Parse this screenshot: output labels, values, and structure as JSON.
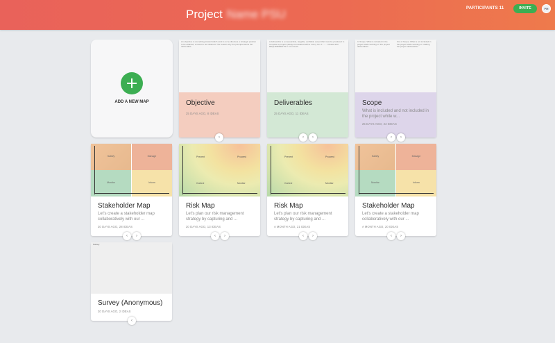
{
  "header": {
    "title": "Project",
    "title_blurred": "Name PSU",
    "participants": "PARTICIPANTS 11",
    "invite": "INVITE",
    "avatar": "PM"
  },
  "add_map": {
    "label": "ADD A NEW MAP"
  },
  "cards": {
    "objective": {
      "title": "Objective",
      "meta": "25 DAYS AGO, 8 IDEAS",
      "thumb_text": "An objective is something toward which work is to be directed, a strategic position to be attained, a result to be obtained. The reason why the principal wants the deliverable."
    },
    "deliverables": {
      "title": "Deliverables",
      "meta": "25 DAYS AGO, 11 IDEAS",
      "thumb_text": "A deliverable is a measurable, tangible, verifiable output that must be produced to complete a project (always formulated with a noun). Ex: A ........ Please add REQUIREMENTS in comments"
    },
    "scope": {
      "title": "Scope",
      "desc": "What is included and not included in the project while w...",
      "meta": "25 DAYS AGO, 22 IDEAS",
      "thumb_text_left": "In Scope: What is included in the project while working on the project deliverables",
      "thumb_text_right": "Out of Scope: What is not included in the project while working on making the project deliverables"
    },
    "stakeholder1": {
      "title": "Stakeholder Map",
      "desc": "Let's create a stakeholder map collaboratively with our ...",
      "meta": "20 DAYS AGO, 28 IDEAS",
      "quads": [
        "Satisfy",
        "Manage",
        "Monitor",
        "Inform"
      ]
    },
    "risk1": {
      "title": "Risk Map",
      "desc": "Let's plan our risk management strategy by capturing and ...",
      "meta": "20 DAYS AGO, 13 IDEAS",
      "labels": [
        "Prevent",
        "Proceed",
        "Control",
        "Monitor"
      ]
    },
    "risk2": {
      "title": "Risk Map",
      "desc": "Let's plan our risk management strategy by capturing and ...",
      "meta": "A MONTH AGO, 21 IDEAS",
      "labels": [
        "Prevent",
        "Proceed",
        "Control",
        "Monitor"
      ]
    },
    "stakeholder2": {
      "title": "Stakeholder Map",
      "desc": "Let's create a stakeholder map collaboratively with our ...",
      "meta": "A MONTH AGO, 20 IDEAS",
      "quads": [
        "Satisfy",
        "Manage",
        "Monitor",
        "Inform"
      ]
    },
    "survey": {
      "title": "Survey (Anonymous)",
      "meta": "20 DAYS AGO, 2 IDEAS",
      "thumb_text": "Survey"
    }
  },
  "nav": {
    "prev": "‹",
    "next": "›"
  },
  "colors": {
    "objective": "#f4cdbf",
    "deliverables": "#d3e8d5",
    "scope": "#ddd5ea",
    "accent": "#3cae52"
  }
}
